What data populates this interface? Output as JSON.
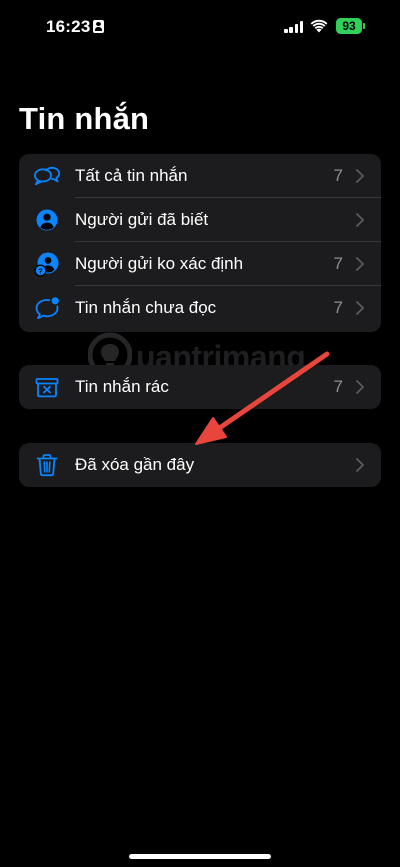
{
  "status_bar": {
    "time": "16:23",
    "battery": "93"
  },
  "page": {
    "title": "Tin nhắn"
  },
  "filters": [
    {
      "label": "Tất cả tin nhắn",
      "count": "7",
      "icon": "all-messages-icon"
    },
    {
      "label": "Người gửi đã biết",
      "count": "",
      "icon": "known-sender-icon"
    },
    {
      "label": "Người gửi ko xác định",
      "count": "7",
      "icon": "unknown-sender-icon"
    },
    {
      "label": "Tin nhắn chưa đọc",
      "count": "7",
      "icon": "unread-message-icon"
    }
  ],
  "junk": {
    "label": "Tin nhắn rác",
    "count": "7",
    "icon": "junk-icon"
  },
  "recently_deleted": {
    "label": "Đã xóa gần đây",
    "count": "",
    "icon": "trash-icon"
  },
  "watermark": {
    "text": "uantrimang"
  },
  "colors": {
    "accent": "#0a84ff",
    "background": "#000000",
    "group_background": "#1c1c1e",
    "secondary_text": "#8e8e93",
    "arrow": "#e8453c",
    "battery": "#31d158"
  }
}
